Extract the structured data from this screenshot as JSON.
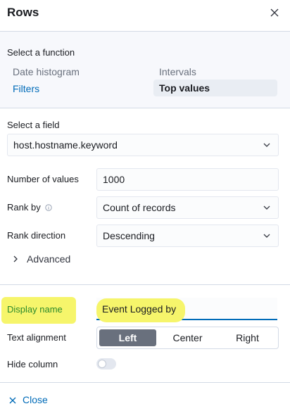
{
  "header": {
    "title": "Rows"
  },
  "function_section": {
    "label": "Select a function",
    "items": [
      {
        "label": "Date histogram",
        "state": "disabled"
      },
      {
        "label": "Intervals",
        "state": "disabled"
      },
      {
        "label": "Filters",
        "state": "link"
      },
      {
        "label": "Top values",
        "state": "selected"
      }
    ]
  },
  "field_section": {
    "label": "Select a field",
    "value": "host.hostname.keyword"
  },
  "number_of_values": {
    "label": "Number of values",
    "value": "1000"
  },
  "rank_by": {
    "label": "Rank by",
    "value": "Count of records"
  },
  "rank_direction": {
    "label": "Rank direction",
    "value": "Descending"
  },
  "advanced": {
    "label": "Advanced"
  },
  "display_name": {
    "label": "Display name",
    "value": "Event Logged by"
  },
  "text_alignment": {
    "label": "Text alignment",
    "options": [
      "Left",
      "Center",
      "Right"
    ],
    "selected": "Left"
  },
  "hide_column": {
    "label": "Hide column",
    "enabled": false
  },
  "footer": {
    "close_label": "Close"
  },
  "colors": {
    "link": "#006bb8",
    "highlight": "#f6f56b",
    "active_button": "#69707d"
  }
}
